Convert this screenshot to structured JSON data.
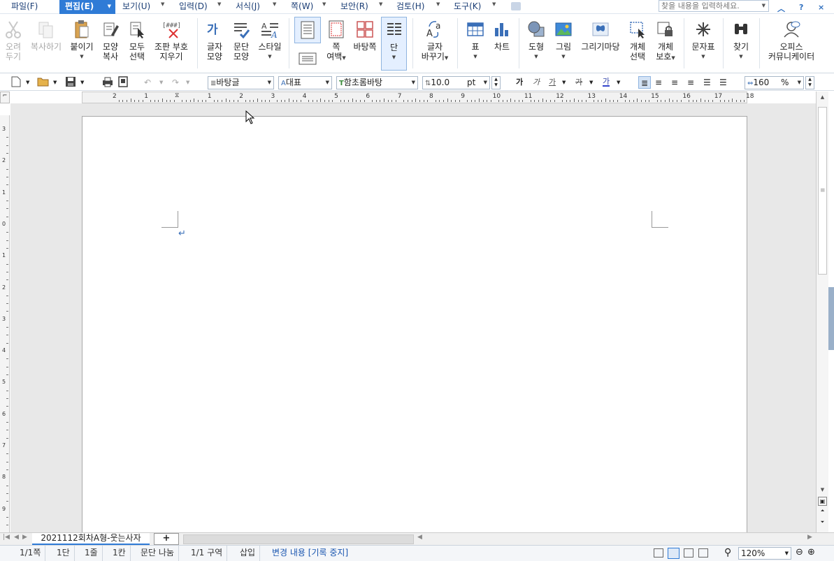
{
  "menubar": {
    "items": [
      {
        "label": "파일(F)"
      },
      {
        "label": "편집(E)"
      },
      {
        "label": "보기(U)"
      },
      {
        "label": "입력(D)"
      },
      {
        "label": "서식(J)"
      },
      {
        "label": "쪽(W)"
      },
      {
        "label": "보안(R)"
      },
      {
        "label": "검토(H)"
      },
      {
        "label": "도구(K)"
      }
    ],
    "search_placeholder": "찾을 내용을 입력하세요.",
    "window_buttons": [
      "^",
      "?",
      "×"
    ]
  },
  "ribbon": {
    "cut": {
      "line1": "오려",
      "line2": "두기"
    },
    "copy": {
      "line1": "복사하기"
    },
    "paste": {
      "line1": "붙이기"
    },
    "format_copy": {
      "line1": "모양",
      "line2": "복사"
    },
    "select_all": {
      "line1": "모두",
      "line2": "선택"
    },
    "erase_marks": {
      "line1": "조판 부호",
      "line2": "지우기"
    },
    "char_shape": {
      "line1": "글자",
      "line2": "모양"
    },
    "para_shape": {
      "line1": "문단",
      "line2": "모양"
    },
    "style": {
      "line1": "스타일"
    },
    "page_margin": {
      "line1": "쪽",
      "line2": "여백"
    },
    "background": {
      "line1": "바탕쪽"
    },
    "column": {
      "line1": "단"
    },
    "change_char": {
      "line1": "글자",
      "line2": "바꾸기"
    },
    "table": {
      "line1": "표"
    },
    "chart": {
      "line1": "차트"
    },
    "shape": {
      "line1": "도형"
    },
    "picture": {
      "line1": "그림"
    },
    "drawing_board": {
      "line1": "그리기마당"
    },
    "object_select": {
      "line1": "개체",
      "line2": "선택"
    },
    "object_protect": {
      "line1": "개체",
      "line2": "보호"
    },
    "symbol": {
      "line1": "문자표"
    },
    "find": {
      "line1": "찾기"
    },
    "office_comm": {
      "line1": "오피스",
      "line2": "커뮤니케이터"
    }
  },
  "toolbar": {
    "style_combo": "바탕글",
    "lang_combo": "대표",
    "font_combo": "함초롬바탕",
    "font_size": "10.0",
    "size_unit": "pt",
    "char_width": "160",
    "width_unit": "%",
    "bold": "가",
    "italic": "가",
    "underline": "가",
    "strike": "가",
    "color": "가"
  },
  "ruler": {
    "ticks": [
      "2",
      "1",
      "",
      "1",
      "2",
      "3",
      "4",
      "5",
      "6",
      "7",
      "8",
      "9",
      "10",
      "11",
      "12",
      "13",
      "14",
      "15",
      "16",
      "17",
      "18"
    ]
  },
  "vruler": {
    "ticks": [
      "3",
      "2",
      "1",
      "0",
      "1",
      "2",
      "3",
      "4",
      "5",
      "6",
      "7",
      "8",
      "9"
    ]
  },
  "document": {
    "para_mark": "↵"
  },
  "tabs": {
    "doc_tab": "2021112회차A형-웃는사자",
    "add": "+"
  },
  "status": {
    "page": "1/1쪽",
    "column": "1단",
    "line": "1줄",
    "col": "1칸",
    "para_break": "문단 나눔",
    "section": "1/1 구역",
    "insert_mode": "삽입",
    "track_changes": "변경 내용 [기록 중지]",
    "zoom": "120%"
  },
  "colors": {
    "accent": "#2f7bd6",
    "menu_text": "#1a3d75",
    "workspace": "#e8e8e8"
  }
}
